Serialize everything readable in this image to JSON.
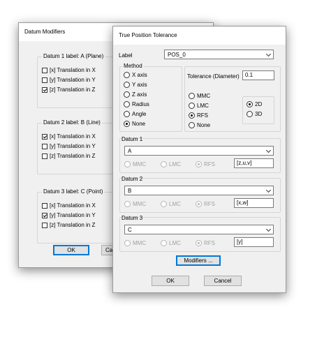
{
  "datum_modifiers": {
    "title": "Datum Modifiers",
    "groups": [
      {
        "label": "Datum 1 label: A (Plane)",
        "items": [
          {
            "label": "[x] Translation in X",
            "checked": false
          },
          {
            "label": "[y] Translation in Y",
            "checked": false
          },
          {
            "label": "[z] Translation in Z",
            "checked": true
          }
        ]
      },
      {
        "label": "Datum 2 label: B (Line)",
        "items": [
          {
            "label": "[x] Translation in X",
            "checked": true
          },
          {
            "label": "[y] Translation in Y",
            "checked": false
          },
          {
            "label": "[z] Translation in Z",
            "checked": false
          }
        ]
      },
      {
        "label": "Datum 3 label: C (Point)",
        "items": [
          {
            "label": "[x] Translation in X",
            "checked": false
          },
          {
            "label": "[y] Translation in Y",
            "checked": true
          },
          {
            "label": "[z] Translation in Z",
            "checked": false
          }
        ]
      }
    ],
    "ok_label": "OK",
    "cancel_label": "Ca"
  },
  "tpt": {
    "title": "True Position Tolerance",
    "label_caption": "Label",
    "label_value": "POS_0",
    "method_caption": "Method",
    "methods": [
      "X axis",
      "Y axis",
      "Z axis",
      "Radius",
      "Angle",
      "None"
    ],
    "method_selected": 5,
    "tolerance_caption": "Tolerance (Diameter)",
    "tolerance_value": "0.1",
    "material_options": [
      "MMC",
      "LMC",
      "RFS",
      "None"
    ],
    "material_selected": 2,
    "dim_options": [
      "2D",
      "3D"
    ],
    "dim_selected": 0,
    "datums": [
      {
        "caption": "Datum 1",
        "value": "A",
        "modifier": "[z,u,v]"
      },
      {
        "caption": "Datum 2",
        "value": "B",
        "modifier": "[x,w]"
      },
      {
        "caption": "Datum 3",
        "value": "C",
        "modifier": "[y]"
      }
    ],
    "datum_material_options": [
      "MMC",
      "LMC",
      "RFS"
    ],
    "datum_material_selected": 2,
    "modifiers_label": "Modifiers ...",
    "ok_label": "OK",
    "cancel_label": "Cancel"
  }
}
